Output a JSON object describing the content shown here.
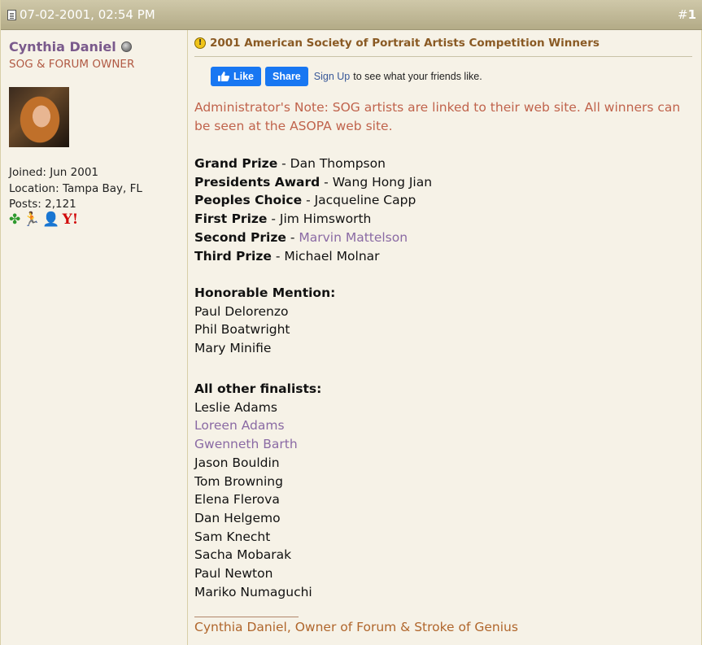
{
  "header": {
    "date": "07-02-2001, 02:54 PM",
    "post_number_prefix": "#",
    "post_number": "1"
  },
  "user": {
    "name": "Cynthia Daniel",
    "title": "SOG & FORUM OWNER",
    "joined": "Joined: Jun 2001",
    "location": "Location: Tampa Bay, FL",
    "posts": "Posts: 2,121",
    "icons": [
      "clover-icon",
      "runner-icon",
      "person-icon",
      "yahoo-icon"
    ]
  },
  "post": {
    "title": "2001 American Society of Portrait Artists Competition Winners",
    "facebook": {
      "like": "Like",
      "share": "Share",
      "signup": "Sign Up",
      "text": "to see what your friends like."
    },
    "admin_note": "Administrator's Note: SOG artists are linked to their web site. All winners can be seen at the ASOPA web site.",
    "winners": [
      {
        "award": "Grand Prize",
        "sep": " - ",
        "name": "Dan Thompson",
        "linked": false
      },
      {
        "award": "Presidents Award",
        "sep": " - ",
        "name": "Wang Hong Jian",
        "linked": false
      },
      {
        "award": "Peoples Choice",
        "sep": " - ",
        "name": "Jacqueline Capp",
        "linked": false
      },
      {
        "award": "First Prize",
        "sep": " - ",
        "name": "Jim Himsworth",
        "linked": false
      },
      {
        "award": "Second Prize",
        "sep": " - ",
        "name": "Marvin Mattelson",
        "linked": true
      },
      {
        "award": "Third Prize",
        "sep": " - ",
        "name": "Michael Molnar",
        "linked": false
      }
    ],
    "honorable_heading": "Honorable Mention:",
    "honorable": [
      "Paul Delorenzo",
      "Phil Boatwright",
      "Mary Minifie"
    ],
    "finalists_heading": "All other finalists:",
    "finalists": [
      {
        "name": "Leslie Adams",
        "linked": false
      },
      {
        "name": "Loreen Adams",
        "linked": true
      },
      {
        "name": "Gwenneth Barth",
        "linked": true
      },
      {
        "name": "Jason Bouldin",
        "linked": false
      },
      {
        "name": "Tom Browning",
        "linked": false
      },
      {
        "name": "Elena Flerova",
        "linked": false
      },
      {
        "name": "Dan Helgemo",
        "linked": false
      },
      {
        "name": "Sam Knecht",
        "linked": false
      },
      {
        "name": "Sacha Mobarak",
        "linked": false
      },
      {
        "name": "Paul Newton",
        "linked": false
      },
      {
        "name": "Mariko Numaguchi",
        "linked": false
      }
    ],
    "signature": "Cynthia Daniel, Owner of Forum & Stroke of Genius"
  },
  "colors": {
    "header": "#b3ab87",
    "username": "#7a5a8c",
    "user_title": "#b15a44",
    "thread_title": "#8a5a24",
    "admin_note": "#c0634c",
    "link": "#8a6aa4",
    "facebook": "#1877f2"
  }
}
